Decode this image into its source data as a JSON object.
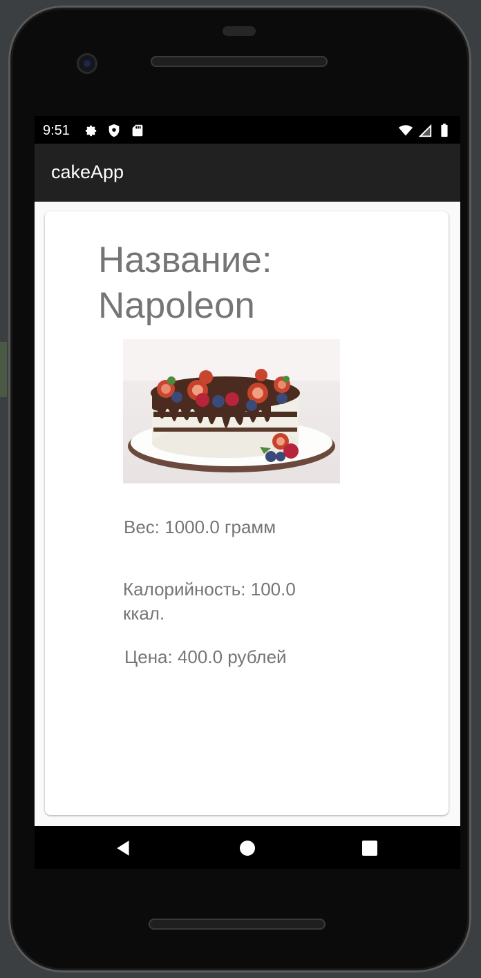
{
  "status_bar": {
    "time": "9:51",
    "left_icons": [
      "settings-icon",
      "shield-icon",
      "sd-card-icon"
    ],
    "right_icons": [
      "wifi-icon",
      "cell-signal-icon",
      "battery-icon"
    ]
  },
  "app_bar": {
    "title": "cakeApp"
  },
  "cake": {
    "title": "Название: Napoleon",
    "image_alt": "cake",
    "weight": "Вес: 1000.0 грамм",
    "calories": "Калорийность: 100.0 ккал.",
    "price": "Цена: 400.0 рублей"
  },
  "nav_bar": {
    "buttons": [
      "back-icon",
      "home-icon",
      "recents-icon"
    ]
  },
  "colors": {
    "app_bar": "#212121",
    "text_secondary": "#757575",
    "card": "#ffffff"
  }
}
